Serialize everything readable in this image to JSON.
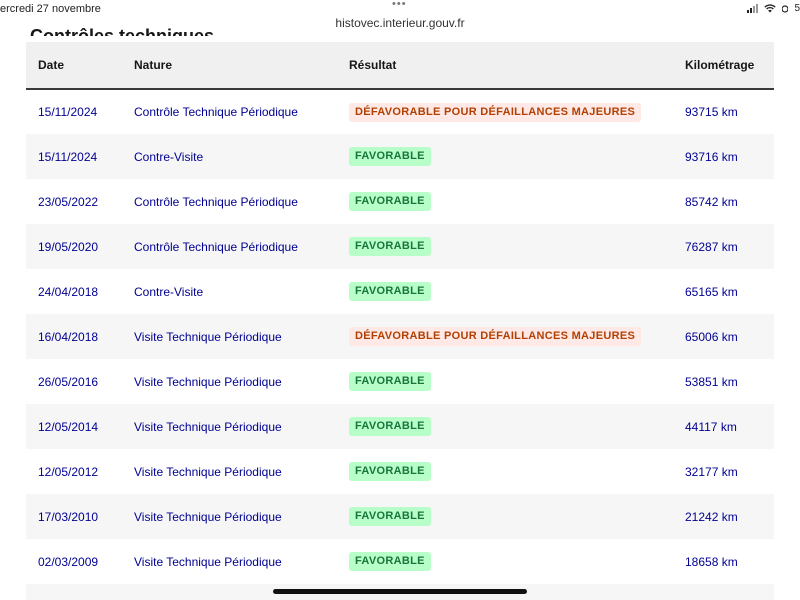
{
  "status_bar": {
    "date": "ercredi 27 novembre",
    "battery": "5"
  },
  "browser": {
    "url": "histovec.interieur.gouv.fr"
  },
  "section_heading": "Contrôles techniques",
  "table": {
    "headers": {
      "date": "Date",
      "nature": "Nature",
      "result": "Résultat",
      "mileage": "Kilométrage"
    },
    "rows": [
      {
        "date": "15/11/2024",
        "nature": "Contrôle Technique Périodique",
        "result": "DÉFAVORABLE POUR DÉFAILLANCES MAJEURES",
        "status": "defav",
        "mileage": "93715 km"
      },
      {
        "date": "15/11/2024",
        "nature": "Contre-Visite",
        "result": "FAVORABLE",
        "status": "fav",
        "mileage": "93716 km"
      },
      {
        "date": "23/05/2022",
        "nature": "Contrôle Technique Périodique",
        "result": "FAVORABLE",
        "status": "fav",
        "mileage": "85742 km"
      },
      {
        "date": "19/05/2020",
        "nature": "Contrôle Technique Périodique",
        "result": "FAVORABLE",
        "status": "fav",
        "mileage": "76287 km"
      },
      {
        "date": "24/04/2018",
        "nature": "Contre-Visite",
        "result": "FAVORABLE",
        "status": "fav",
        "mileage": "65165 km"
      },
      {
        "date": "16/04/2018",
        "nature": "Visite Technique Périodique",
        "result": "DÉFAVORABLE POUR DÉFAILLANCES MAJEURES",
        "status": "defav",
        "mileage": "65006 km"
      },
      {
        "date": "26/05/2016",
        "nature": "Visite Technique Périodique",
        "result": "FAVORABLE",
        "status": "fav",
        "mileage": "53851 km"
      },
      {
        "date": "12/05/2014",
        "nature": "Visite Technique Périodique",
        "result": "FAVORABLE",
        "status": "fav",
        "mileage": "44117 km"
      },
      {
        "date": "12/05/2012",
        "nature": "Visite Technique Périodique",
        "result": "FAVORABLE",
        "status": "fav",
        "mileage": "32177 km"
      },
      {
        "date": "17/03/2010",
        "nature": "Visite Technique Périodique",
        "result": "FAVORABLE",
        "status": "fav",
        "mileage": "21242 km"
      },
      {
        "date": "02/03/2009",
        "nature": "Visite Technique Périodique",
        "result": "FAVORABLE",
        "status": "fav",
        "mileage": "18658 km"
      },
      {
        "date": "",
        "nature": "",
        "result": "",
        "status": "fav",
        "mileage": ""
      }
    ]
  },
  "colors": {
    "link_text": "#000091",
    "favorable_bg": "#b8fec9",
    "favorable_text": "#18753c",
    "defavorable_bg": "#ffe9e6",
    "defavorable_text": "#b34000"
  },
  "icons": [
    "cellular-signal-icon",
    "wifi-icon",
    "battery-icon",
    "more-dots-icon"
  ]
}
